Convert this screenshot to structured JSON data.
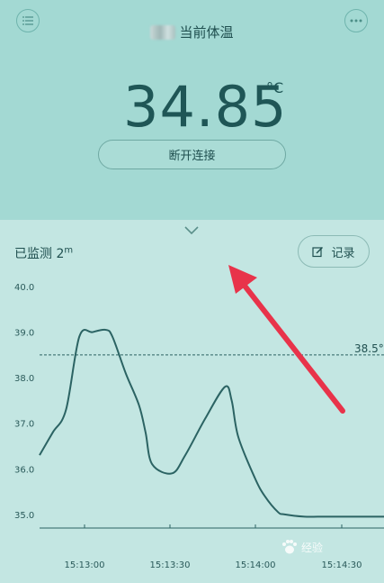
{
  "header": {
    "title": "当前体温",
    "menu_icon": "list-icon",
    "more_icon": "more-horizontal-icon"
  },
  "reading": {
    "value": "34.85",
    "unit": "°C"
  },
  "disconnect_label": "断开连接",
  "monitor": {
    "label": "已监测 2",
    "unit_sup": "m"
  },
  "record_label": "记录",
  "colors": {
    "top_bg": "#a3d9d3",
    "bottom_bg": "#c3e6e2",
    "line": "#2b6363",
    "arrow": "#e8334a"
  },
  "chart_data": {
    "type": "line",
    "ylim": [
      34.7,
      40.0
    ],
    "y_ticks": [
      "40.0",
      "39.0",
      "38.0",
      "37.0",
      "36.0",
      "35.0"
    ],
    "x_ticks": [
      "15:13:00",
      "15:13:30",
      "15:14:00",
      "15:14:30"
    ],
    "threshold": {
      "value": 38.5,
      "label": "38.5°"
    },
    "series": [
      {
        "x": [
          0,
          8,
          16,
          24,
          32,
          40,
          44,
          52,
          60,
          64,
          68,
          80,
          88,
          100,
          112,
          116,
          120,
          130,
          136,
          144,
          148,
          160,
          168,
          176,
          180,
          184,
          192,
          200,
          208
        ],
        "values": [
          36.3,
          36.8,
          37.3,
          38.9,
          39.0,
          39.05,
          38.9,
          38.1,
          37.4,
          36.8,
          36.1,
          35.9,
          36.3,
          37.1,
          37.8,
          37.5,
          36.7,
          35.8,
          35.4,
          35.05,
          35.0,
          34.95,
          34.95,
          34.95,
          34.95,
          34.95,
          34.95,
          34.95,
          34.95
        ]
      }
    ]
  },
  "watermark": "经验"
}
